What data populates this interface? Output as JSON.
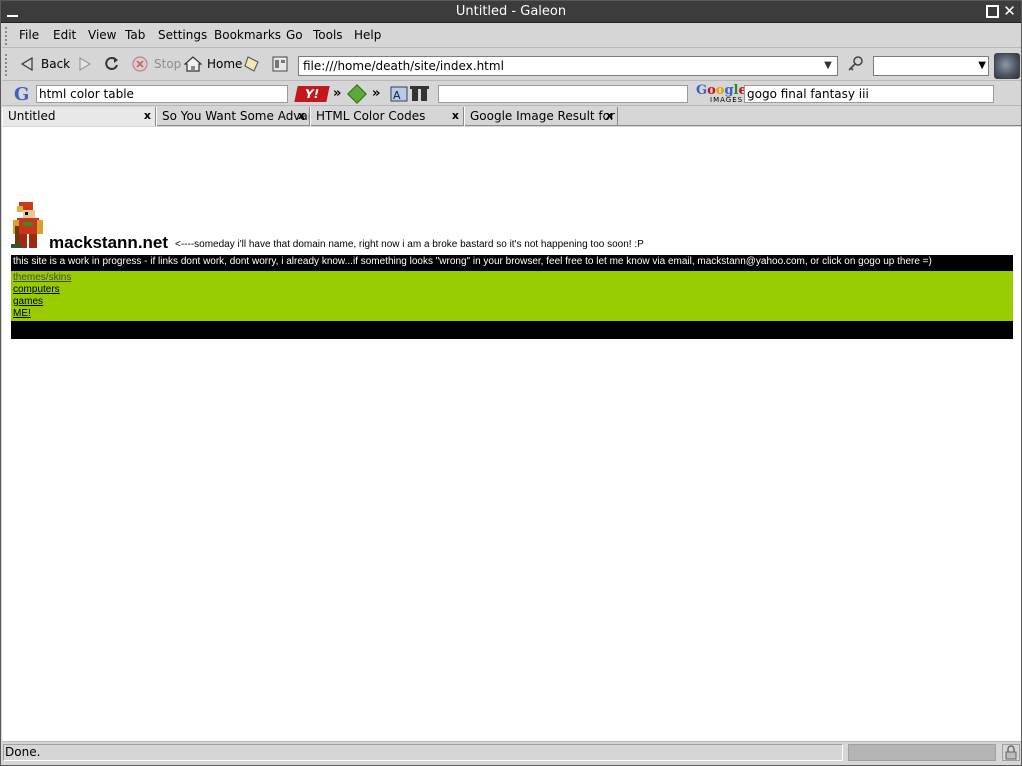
{
  "window": {
    "title": "Untitled - Galeon"
  },
  "menu": [
    "File",
    "Edit",
    "View",
    "Tab",
    "Settings",
    "Bookmarks",
    "Go",
    "Tools",
    "Help"
  ],
  "nav": {
    "back": "Back",
    "stop": "Stop",
    "home": "Home",
    "url": "file:///home/death/site/index.html"
  },
  "search": {
    "google_query": "html color table",
    "middle_query": "",
    "google_images_logo_top": "Google",
    "google_images_logo_bottom": "IMAGES",
    "google_images_query": "gogo final fantasy iii",
    "arrow": "»"
  },
  "tabs": [
    {
      "label": "Untitled"
    },
    {
      "label": "So You Want Some Advan"
    },
    {
      "label": "HTML Color Codes"
    },
    {
      "label": "Google Image Result for v"
    }
  ],
  "page": {
    "site_title": "mackstann.net",
    "tagline": "<----someday i'll have that domain name, right now i am a broke bastard so it's not happening too soon! :P",
    "notice": "this site is a work in progress - if links dont work, dont worry, i already know...if something looks \"wrong\" in your browser, feel free to let me know via email, mackstann@yahoo.com, or click on gogo up there =)",
    "links": [
      "themes/skins",
      "computers",
      "games",
      "ME!"
    ]
  },
  "status": {
    "text": "Done."
  },
  "colors": {
    "green_panel": "#99cc00",
    "titlebar": "#3c3c3c"
  }
}
